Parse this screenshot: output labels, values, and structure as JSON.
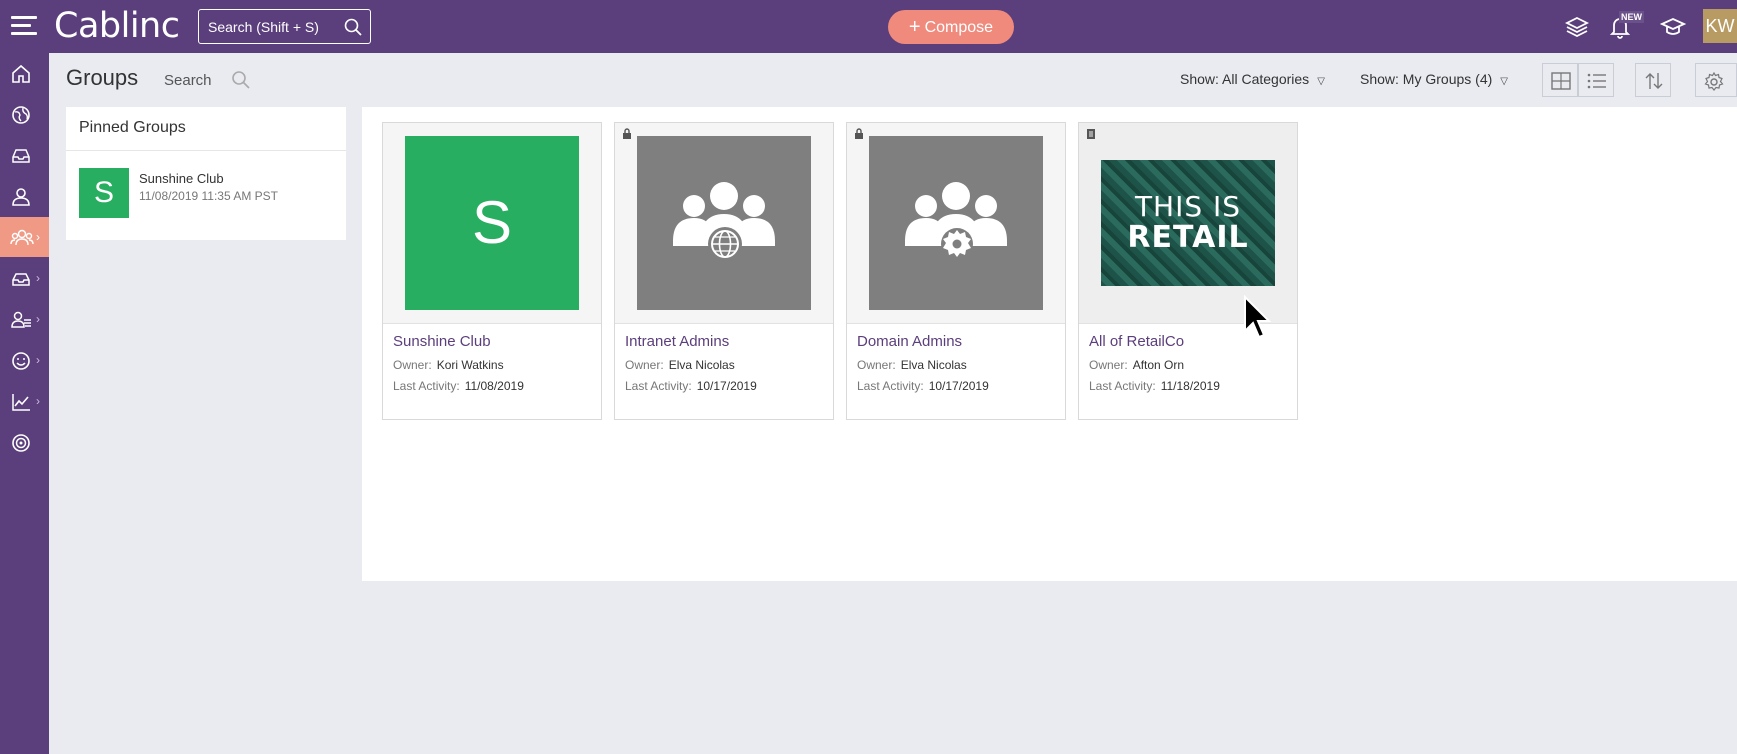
{
  "app": {
    "logo": "Cablinc"
  },
  "topbar": {
    "search_placeholder": "Search (Shift + S)",
    "compose_plus": "+",
    "compose_label": "Compose",
    "new_badge": "NEW",
    "avatar_initials": "KW",
    "icons": [
      "layers-icon",
      "bell-icon",
      "graduation-cap-icon"
    ]
  },
  "leftnav": {
    "items": [
      {
        "icon": "home-icon"
      },
      {
        "icon": "globe-icon"
      },
      {
        "icon": "inbox-icon"
      },
      {
        "icon": "user-icon"
      },
      {
        "icon": "groups-icon",
        "active": true
      },
      {
        "icon": "tray-icon"
      },
      {
        "icon": "users-icon"
      },
      {
        "icon": "smile-icon"
      },
      {
        "icon": "chart-icon"
      },
      {
        "icon": "target-icon"
      }
    ]
  },
  "page": {
    "title": "Groups",
    "search_label": "Search",
    "filter_categories": "Show: All Categories",
    "filter_groups": "Show: My Groups (4)"
  },
  "pinned": {
    "title": "Pinned Groups",
    "items": [
      {
        "initial": "S",
        "name": "Sunshine Club",
        "date": "11/08/2019 11:35 AM PST",
        "color": "#27ae60"
      }
    ]
  },
  "groups": {
    "owner_label": "Owner:",
    "activity_label": "Last Activity:",
    "cards": [
      {
        "name": "Sunshine Club",
        "owner": "Kori Watkins",
        "last_activity": "11/08/2019",
        "thumb": "letter",
        "initial": "S",
        "color": "#27ae60",
        "badge_icon": ""
      },
      {
        "name": "Intranet Admins",
        "owner": "Elva Nicolas",
        "last_activity": "10/17/2019",
        "thumb": "group-globe",
        "color": "#7f7f7f",
        "badge_icon": "lock-icon"
      },
      {
        "name": "Domain Admins",
        "owner": "Elva Nicolas",
        "last_activity": "10/17/2019",
        "thumb": "group-gear",
        "color": "#7f7f7f",
        "badge_icon": "lock-icon"
      },
      {
        "name": "All of RetailCo",
        "owner": "Afton Orn",
        "last_activity": "11/18/2019",
        "thumb": "image",
        "color": "#1f5a4e",
        "badge_icon": "document-icon",
        "image_text_line1": "THIS IS",
        "image_text_line2": "RETAIL"
      }
    ]
  }
}
